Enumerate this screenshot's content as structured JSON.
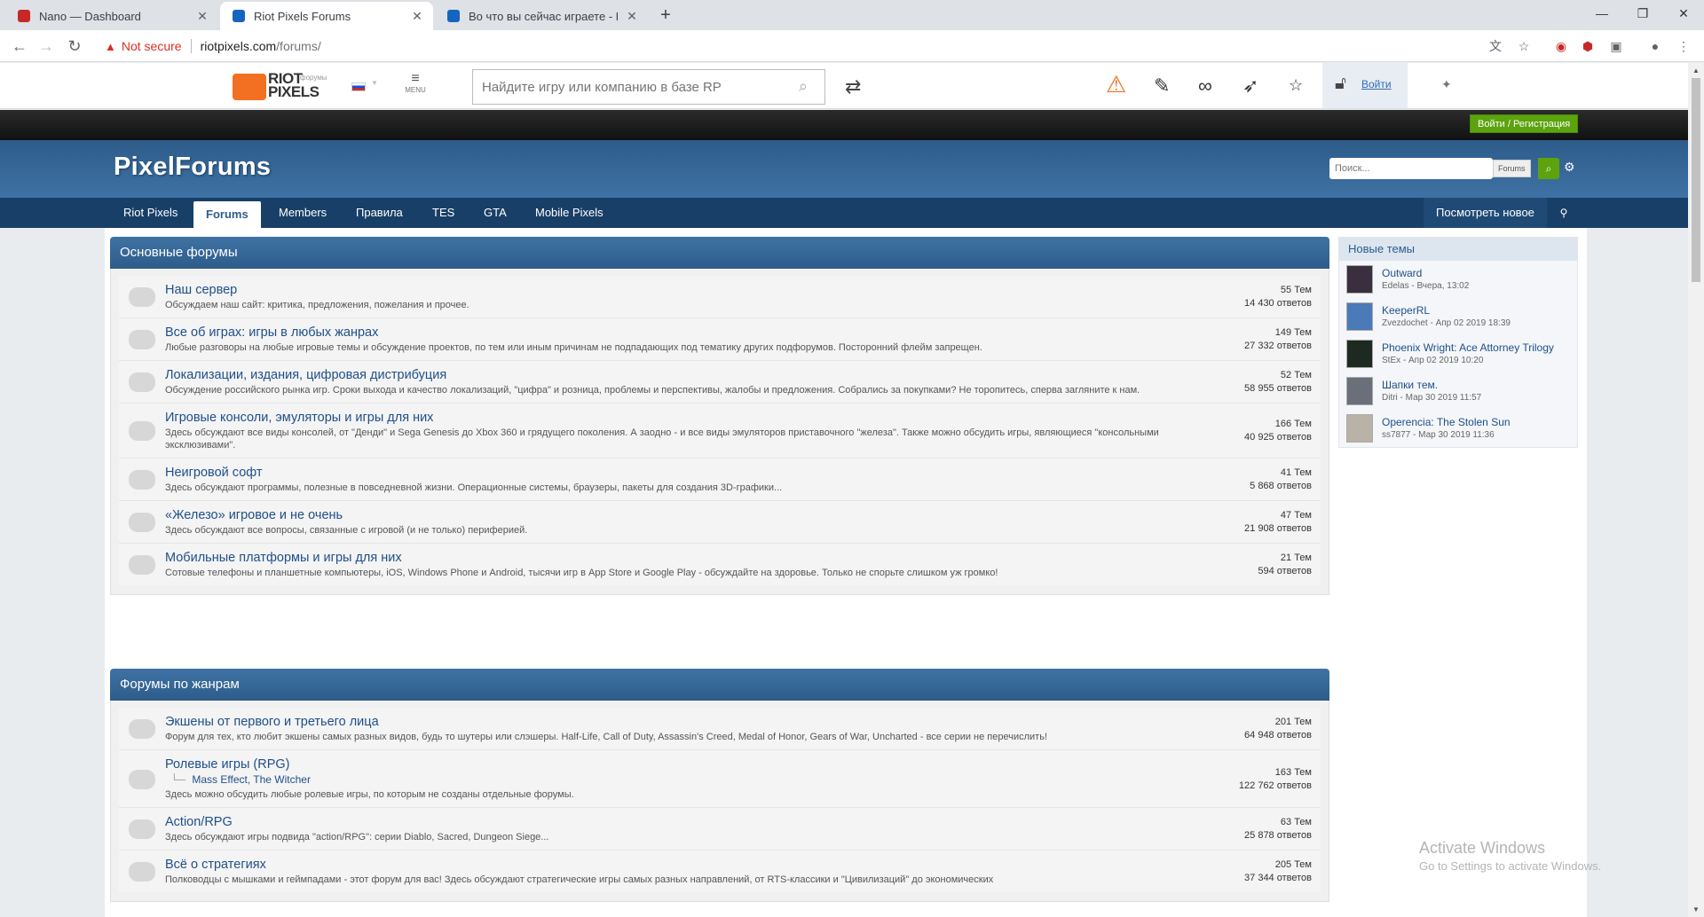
{
  "browser": {
    "tabs": [
      {
        "title": "Nano — Dashboard",
        "color": "#c62828"
      },
      {
        "title": "Riot Pixels Forums",
        "color": "#1565c0"
      },
      {
        "title": "Во что вы сейчас играете - Все",
        "color": "#1565c0"
      }
    ],
    "new_tab": "+",
    "window": {
      "minimize": "—",
      "restore": "❐",
      "close": "✕"
    },
    "not_secure": "Not secure",
    "url_host": "riotpixels.com",
    "url_path": "/forums/"
  },
  "rp_header": {
    "logo_line1": "RIOT",
    "logo_line2": "PIXELS",
    "logo_sub": "форумы",
    "menu_label": "MENU",
    "search_placeholder": "Найдите игру или компанию в базе RP",
    "login": "Войти"
  },
  "register_button": "Войти / Регистрация",
  "forum_header": {
    "title": "PixelForums",
    "search_placeholder": "Поиск...",
    "search_scope": "Forums"
  },
  "nav": {
    "items": [
      "Riot Pixels",
      "Forums",
      "Members",
      "Правила",
      "TES",
      "GTA",
      "Mobile Pixels"
    ],
    "active": "Forums",
    "right": "Посмотреть новое"
  },
  "categories": [
    {
      "title": "Основные форумы",
      "forums": [
        {
          "title": "Наш сервер",
          "desc": "Обсуждаем наш сайт: критика, предложения, пожелания и прочее.",
          "topics": "55 Тем",
          "replies": "14 430 ответов"
        },
        {
          "title": "Все об играх: игры в любых жанрах",
          "desc": "Любые разговоры на любые игровые темы и обсуждение проектов, по тем или иным причинам не подпадающих под тематику других подфорумов. Посторонний флейм запрещен.",
          "topics": "149 Тем",
          "replies": "27 332 ответов"
        },
        {
          "title": "Локализации, издания, цифровая дистрибуция",
          "desc": "Обсуждение российского рынка игр. Сроки выхода и качество локализаций, \"цифра\" и розница, проблемы и перспективы, жалобы и предложения. Собрались за покупками? Не торопитесь, сперва загляните к нам.",
          "topics": "52 Тем",
          "replies": "58 955 ответов"
        },
        {
          "title": "Игровые консоли, эмуляторы и игры для них",
          "desc": "Здесь обсуждают все виды консолей, от \"Денди\" и Sega Genesis до Xbox 360 и грядущего поколения. А заодно - и все виды эмуляторов приставочного \"железа\". Также можно обсудить игры, являющиеся \"консольными эксклюзивами\".",
          "topics": "166 Тем",
          "replies": "40 925 ответов"
        },
        {
          "title": "Неигровой софт",
          "desc": "Здесь обсуждают программы, полезные в повседневной жизни. Операционные системы, браузеры, пакеты для создания 3D-графики...",
          "topics": "41 Тем",
          "replies": "5 868 ответов"
        },
        {
          "title": "«Железо» игровое и не очень",
          "desc": "Здесь обсуждают все вопросы, связанные с игровой (и не только) периферией.",
          "topics": "47 Тем",
          "replies": "21 908 ответов"
        },
        {
          "title": "Мобильные платформы и игры для них",
          "desc": "Сотовые телефоны и планшетные компьютеры, iOS, Windows Phone и Android, тысячи игр в App Store и Google Play - обсуждайте на здоровье. Только не спорьте слишком уж громко!",
          "topics": "21 Тем",
          "replies": "594 ответов"
        }
      ]
    },
    {
      "title": "Форумы по жанрам",
      "forums": [
        {
          "title": "Экшены от первого и третьего лица",
          "desc": "Форум для тех, кто любит экшены самых разных видов, будь то шутеры или слэшеры. Half-Life, Call of Duty, Assassin's Creed, Medal of Honor, Gears of War, Uncharted - все серии не перечислить!",
          "topics": "201 Тем",
          "replies": "64 948 ответов"
        },
        {
          "title": "Ролевые игры (RPG)",
          "subforums": [
            "Mass Effect,",
            "The Witcher"
          ],
          "desc": "Здесь можно обсудить любые ролевые игры, по которым не созданы отдельные форумы.",
          "topics": "163 Тем",
          "replies": "122 762 ответов"
        },
        {
          "title": "Action/RPG",
          "desc": "Здесь обсуждают игры подвида \"action/RPG\": серии Diablo, Sacred, Dungeon Siege...",
          "topics": "63 Тем",
          "replies": "25 878 ответов"
        },
        {
          "title": "Всё о стратегиях",
          "desc": "Полководцы с мышками и геймпадами - этот форум для вас! Здесь обсуждают стратегические игры самых разных направлений, от RTS-классики и \"Цивилизаций\" до экономических",
          "topics": "205 Тем",
          "replies": "37 344 ответов"
        }
      ]
    }
  ],
  "sidebar": {
    "title": "Новые темы",
    "items": [
      {
        "title": "Outward",
        "meta": "Edelas - Вчера, 13:02"
      },
      {
        "title": "KeeperRL",
        "meta": "Zvezdochet - Апр 02 2019 18:39"
      },
      {
        "title": "Phoenix Wright: Ace Attorney Trilogy",
        "meta": "StEx - Апр 02 2019 10:20"
      },
      {
        "title": "Шапки тем.",
        "meta": "Ditri - Мар 30 2019 11:57"
      },
      {
        "title": "Operencia: The Stolen Sun",
        "meta": "ss7877 - Мар 30 2019 11:36"
      }
    ]
  },
  "watermark": {
    "line1": "Activate Windows",
    "line2": "Go to Settings to activate Windows."
  }
}
